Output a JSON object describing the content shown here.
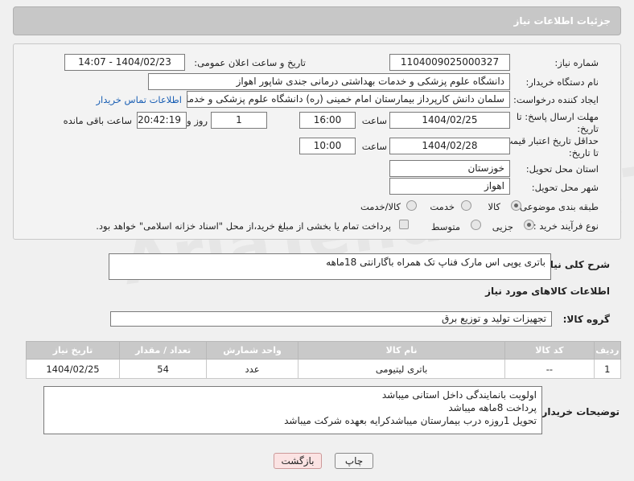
{
  "header": {
    "title": "جزئیات اطلاعات نیاز"
  },
  "form": {
    "need_number_label": "شماره نیاز:",
    "need_number": "1104009025000327",
    "announce_label": "تاریخ و ساعت اعلان عمومی:",
    "announce_value": "1404/02/23 - 14:07",
    "buyer_org_label": "نام دستگاه خریدار:",
    "buyer_org": "دانشگاه علوم پزشکی و خدمات بهداشتی درمانی جندی شاپور اهواز",
    "requester_label": "ایجاد کننده درخواست:",
    "requester": "سلمان دانش کارپرداز بیمارستان امام خمینی (ره) دانشگاه علوم پزشکی و خدما",
    "contact_link": "اطلاعات تماس خریدار",
    "deadline_label": "مهلت ارسال پاسخ: تا تاریخ:",
    "deadline_date": "1404/02/25",
    "time_label": "ساعت",
    "deadline_time": "16:00",
    "days_value": "1",
    "days_label": "روز و",
    "remaining_time": "20:42:19",
    "remaining_label": "ساعت باقی مانده",
    "price_validity_label": "حداقل تاریخ اعتبار قیمت: تا تاریخ:",
    "price_validity_date": "1404/02/28",
    "price_validity_time": "10:00",
    "province_label": "استان محل تحویل:",
    "province": "خوزستان",
    "city_label": "شهر محل تحویل:",
    "city": "اهواز",
    "category_label": "طبقه بندی موضوعی:",
    "category_options": [
      "کالا",
      "خدمت",
      "کالا/خدمت"
    ],
    "process_label": "نوع فرآیند خرید :",
    "process_options": [
      "جزیی",
      "متوسط"
    ],
    "treasury_note": "پرداخت تمام یا بخشی از مبلغ خرید،از محل \"اسناد خزانه اسلامی\" خواهد بود."
  },
  "description": {
    "label": "شرح کلی نیاز:",
    "text": "باتری یوپی اس مارک فناپ تک همراه باگارانتی 18ماهه"
  },
  "goods": {
    "section_title": "اطلاعات کالاهای مورد نیاز",
    "group_label": "گروه کالا:",
    "group_value": "تجهیزات تولید و توزیع برق",
    "columns": [
      "ردیف",
      "کد کالا",
      "نام کالا",
      "واحد شمارش",
      "تعداد / مقدار",
      "تاریخ نیاز"
    ],
    "rows": [
      [
        "1",
        "--",
        "باتری لیتیومی",
        "عدد",
        "54",
        "1404/02/25"
      ]
    ]
  },
  "buyer_notes": {
    "label": "توضیحات خریدار:",
    "text": "اولویت بانمایندگی داخل استانی میباشد\nپرداخت 8ماهه میباشد\nتحویل 1روزه درب بیمارستان میباشدکرایه بعهده شرکت میباشد"
  },
  "buttons": {
    "print": "چاپ",
    "back": "بازگشت"
  },
  "watermark": "AriaTender.neT"
}
